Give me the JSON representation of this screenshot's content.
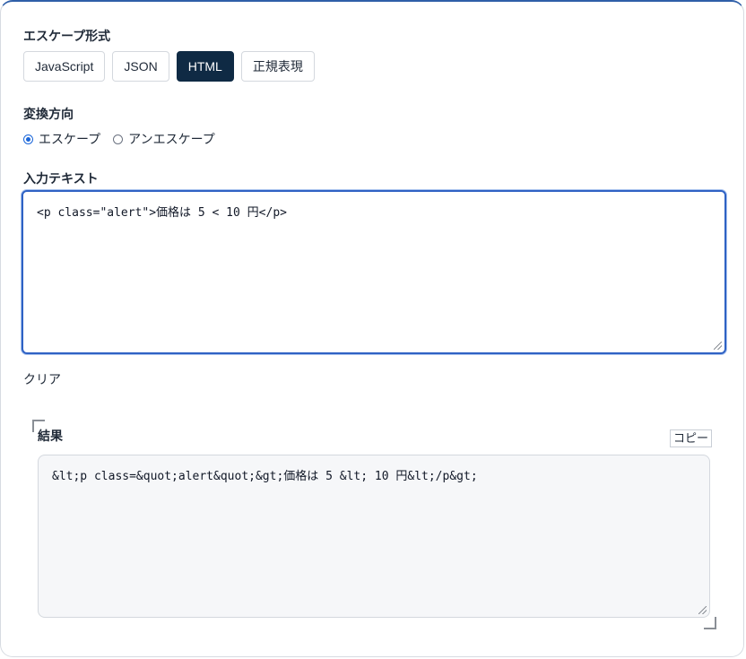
{
  "escape_format": {
    "label": "エスケープ形式",
    "options": [
      "JavaScript",
      "JSON",
      "HTML",
      "正規表現"
    ],
    "selected": "HTML"
  },
  "direction": {
    "label": "変換方向",
    "options": [
      "エスケープ",
      "アンエスケープ"
    ],
    "selected": "エスケープ"
  },
  "input": {
    "label": "入力テキスト",
    "value": "<p class=\"alert\">価格は 5 < 10 円</p>"
  },
  "clear_label": "クリア",
  "result": {
    "label": "結果",
    "copy_label": "コピー",
    "value": "&lt;p class=&quot;alert&quot;&gt;価格は 5 &lt; 10 円&lt;/p&gt;"
  },
  "colors": {
    "accent": "#0f2a44",
    "focus_border": "#2f62c4",
    "radio_checked": "#1a66d9"
  }
}
